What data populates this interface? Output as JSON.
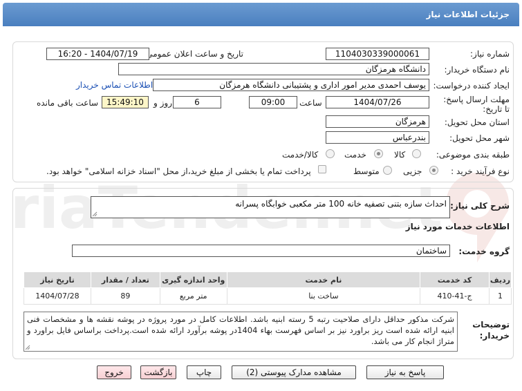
{
  "header": {
    "title": "جزئیات اطلاعات نیاز"
  },
  "form": {
    "need_number_label": "شماره نیاز:",
    "need_number": "1104030339000061",
    "announce_label": "تاریخ و ساعت اعلان عمومی:",
    "announce_value": "1404/07/19 - 16:20",
    "buyer_label": "نام دستگاه خریدار:",
    "buyer_value": "دانشگاه هرمزگان",
    "creator_label": "ایجاد کننده درخواست:",
    "creator_value": "یوسف احمدی مدیر امور اداری و پشتیبانی دانشگاه هرمزگان",
    "contact_link": "اطلاعات تماس خریدار",
    "deadline_label": "مهلت ارسال پاسخ: تا تاریخ:",
    "deadline_date": "1404/07/26",
    "time_label": "ساعت",
    "deadline_time": "09:00",
    "days_value": "6",
    "days_label": "روز و",
    "remaining_time": "15:49:10",
    "remaining_label": "ساعت باقی مانده",
    "province_label": "استان محل تحویل:",
    "province_value": "هرمزگان",
    "city_label": "شهر محل تحویل:",
    "city_value": "بندرعباس",
    "category_label": "طبقه بندی موضوعی:",
    "category_options": [
      "کالا",
      "خدمت",
      "کالا/خدمت"
    ],
    "category_selected": "خدمت",
    "process_label": "نوع فرآیند خرید :",
    "process_options": [
      "جزیی",
      "متوسط"
    ],
    "process_selected": "جزیی",
    "payment_note": "پرداخت تمام یا بخشی از مبلغ خرید،از محل \"اسناد خزانه اسلامی\" خواهد بود."
  },
  "summary": {
    "label": "شرح کلی نیاز:",
    "value": "احداث سازه بتنی تصفیه خانه 100 متر مکعبی خوابگاه پسرانه"
  },
  "services_section": {
    "title": "اطلاعات خدمات مورد نیاز",
    "group_label": "گروه خدمت:",
    "group_value": "ساختمان"
  },
  "table": {
    "headers": [
      "ردیف",
      "کد خدمت",
      "نام خدمت",
      "واحد اندازه گیری",
      "تعداد / مقدار",
      "تاریخ نیاز"
    ],
    "rows": [
      [
        "1",
        "ج-41-410",
        "ساخت بنا",
        "متر مربع",
        "89",
        "1404/07/28"
      ]
    ]
  },
  "buyer_notes": {
    "label": "توضیحات خریدار:",
    "text": "شرکت مذکور حداقل دارای صلاحیت رتبه 5 رسته ابنیه باشد. اطلاعات کامل در مورد پروژه در پوشه نقشه ها و مشخصات فنی ابنیه ارائه شده است ریز براورد نیز بر اساس فهرست بهاء 1404در پوشه برآورد ارائه شده است.پرداخت براساس فایل براورد و متراژ انجام کار می باشد."
  },
  "buttons": {
    "reply": "پاسخ به نیاز",
    "attachments": "مشاهده مدارک پیوستی (2)",
    "print": "چاپ",
    "back": "بازگشت",
    "exit": "خروج"
  },
  "watermark": {
    "text": "AriaTender.net"
  },
  "colors": {
    "header_blue": "#5a8bc8",
    "link_blue": "#1a4fb4",
    "button_pink": "#f7cfd3",
    "watermark_red": "#c0392b"
  }
}
